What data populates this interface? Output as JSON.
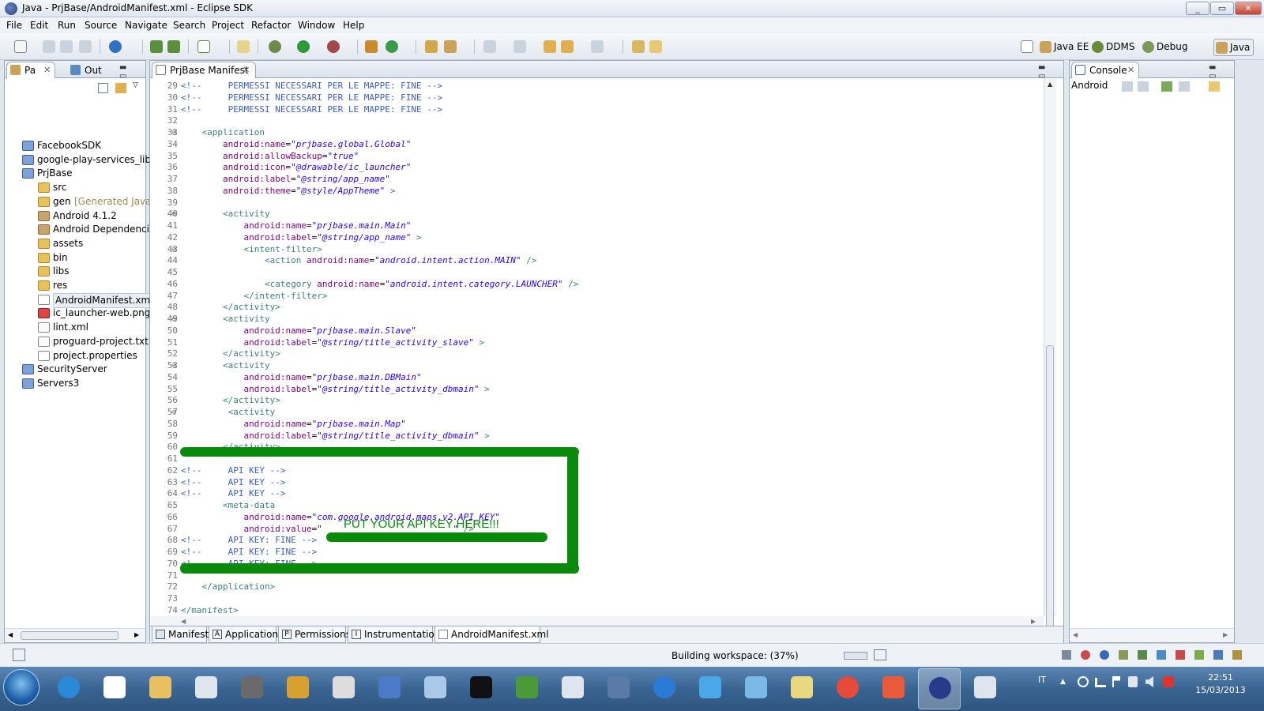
{
  "window": {
    "title": "Java - PrjBase/AndroidManifest.xml - Eclipse SDK"
  },
  "menu": [
    "File",
    "Edit",
    "Run",
    "Source",
    "Navigate",
    "Search",
    "Project",
    "Refactor",
    "Window",
    "Help"
  ],
  "perspectives": [
    {
      "label": "Java EE",
      "icon": "java-ee-perspective-icon"
    },
    {
      "label": "DDMS",
      "icon": "ddms-perspective-icon"
    },
    {
      "label": "Debug",
      "icon": "debug-perspective-icon"
    },
    {
      "label": "Java",
      "icon": "java-perspective-icon",
      "active": true
    }
  ],
  "explorer": {
    "tabs": [
      {
        "label": "Pa"
      },
      {
        "label": "Out"
      }
    ],
    "tree": [
      {
        "label": "FacebookSDK",
        "icon": "project-folder-icon"
      },
      {
        "label": "google-play-services_lib",
        "icon": "project-folder-icon"
      },
      {
        "label": "PrjBase",
        "icon": "project-folder-icon"
      },
      {
        "label": "src",
        "icon": "source-folder-icon"
      },
      {
        "label": "gen",
        "suffix": "[Generated Java F",
        "icon": "source-folder-icon"
      },
      {
        "label": "Android 4.1.2",
        "icon": "library-icon"
      },
      {
        "label": "Android Dependencie",
        "icon": "library-icon"
      },
      {
        "label": "assets",
        "icon": "folder-icon"
      },
      {
        "label": "bin",
        "icon": "folder-icon"
      },
      {
        "label": "libs",
        "icon": "folder-icon"
      },
      {
        "label": "res",
        "icon": "folder-icon"
      },
      {
        "label": "AndroidManifest.xml",
        "icon": "xml-file-icon",
        "selected": true
      },
      {
        "label": "ic_launcher-web.png",
        "icon": "image-file-icon"
      },
      {
        "label": "lint.xml",
        "icon": "xml-file-icon"
      },
      {
        "label": "proguard-project.txt",
        "icon": "text-file-icon"
      },
      {
        "label": "project.properties",
        "icon": "text-file-icon"
      },
      {
        "label": "SecurityServer",
        "icon": "project-folder-icon"
      },
      {
        "label": "Servers3",
        "icon": "project-folder-icon"
      }
    ]
  },
  "editor": {
    "tab_label": "PrjBase Manifest",
    "lines": [
      {
        "n": "29",
        "t": "<!--     PERMESSI NECESSARI PER LE MAPPE: FINE -->"
      },
      {
        "n": "30",
        "t": "<!--     PERMESSI NECESSARI PER LE MAPPE: FINE -->"
      },
      {
        "n": "31",
        "t": "<!--     PERMESSI NECESSARI PER LE MAPPE: FINE -->"
      },
      {
        "n": "32",
        "t": ""
      },
      {
        "n": "33",
        "t": "    <application"
      },
      {
        "n": "34",
        "t": "        android:name=\"prjbase.global.Global\""
      },
      {
        "n": "35",
        "t": "        android:allowBackup=\"true\""
      },
      {
        "n": "36",
        "t": "        android:icon=\"@drawable/ic_launcher\""
      },
      {
        "n": "37",
        "t": "        android:label=\"@string/app_name\""
      },
      {
        "n": "38",
        "t": "        android:theme=\"@style/AppTheme\" >"
      },
      {
        "n": "39",
        "t": ""
      },
      {
        "n": "40",
        "t": "        <activity"
      },
      {
        "n": "41",
        "t": "            android:name=\"prjbase.main.Main\""
      },
      {
        "n": "42",
        "t": "            android:label=\"@string/app_name\" >"
      },
      {
        "n": "43",
        "t": "            <intent-filter>"
      },
      {
        "n": "44",
        "t": "                <action android:name=\"android.intent.action.MAIN\" />"
      },
      {
        "n": "45",
        "t": ""
      },
      {
        "n": "46",
        "t": "                <category android:name=\"android.intent.category.LAUNCHER\" />"
      },
      {
        "n": "47",
        "t": "            </intent-filter>"
      },
      {
        "n": "48",
        "t": "        </activity>"
      },
      {
        "n": "49",
        "t": "        <activity"
      },
      {
        "n": "50",
        "t": "            android:name=\"prjbase.main.Slave\""
      },
      {
        "n": "51",
        "t": "            android:label=\"@string/title_activity_slave\" >"
      },
      {
        "n": "52",
        "t": "        </activity>"
      },
      {
        "n": "53",
        "t": "        <activity"
      },
      {
        "n": "54",
        "t": "            android:name=\"prjbase.main.DBMain\""
      },
      {
        "n": "55",
        "t": "            android:label=\"@string/title_activity_dbmain\" >"
      },
      {
        "n": "56",
        "t": "        </activity>"
      },
      {
        "n": "57",
        "t": "         <activity"
      },
      {
        "n": "58",
        "t": "            android:name=\"prjbase.main.Map\""
      },
      {
        "n": "59",
        "t": "            android:label=\"@string/title_activity_dbmain\" >"
      },
      {
        "n": "60",
        "t": "        </activity>"
      },
      {
        "n": "61",
        "t": ""
      },
      {
        "n": "62",
        "t": "<!--     API KEY -->"
      },
      {
        "n": "63",
        "t": "<!--     API KEY -->"
      },
      {
        "n": "64",
        "t": "<!--     API KEY -->"
      },
      {
        "n": "65",
        "t": "        <meta-data"
      },
      {
        "n": "66",
        "t": "            android:name=\"com.google.android.maps.v2.API_KEY\""
      },
      {
        "n": "67",
        "t": "            android:value=\"                         \" />"
      },
      {
        "n": "68",
        "t": "<!--     API KEY: FINE -->"
      },
      {
        "n": "69",
        "t": "<!--     API KEY: FINE -->"
      },
      {
        "n": "70",
        "t": "<!--     API KEY: FINE -->"
      },
      {
        "n": "71",
        "t": ""
      },
      {
        "n": "72",
        "t": "    </application>"
      },
      {
        "n": "73",
        "t": ""
      },
      {
        "n": "74",
        "t": "</manifest>"
      }
    ],
    "annotation": "PUT YOUR API KEY HERE!!!",
    "bottom_tabs": [
      {
        "label": "Manifest",
        "icon": "manifest-tab-icon"
      },
      {
        "label": "Application",
        "key": "A"
      },
      {
        "label": "Permissions",
        "key": "P"
      },
      {
        "label": "Instrumentation",
        "key": "I"
      },
      {
        "label": "AndroidManifest.xml",
        "icon": "xml-file-icon",
        "active": true
      }
    ]
  },
  "console": {
    "tab_label": "Console",
    "label": "Android"
  },
  "status": {
    "text": "Building workspace: (37%)"
  },
  "taskbar": {
    "apps": [
      "internet-explorer-icon",
      "7zip-icon",
      "explorer-icon",
      "calculator-icon",
      "gimp-icon",
      "tool-icon",
      "database-icon",
      "network-icon",
      "settings-icon",
      "terminal-icon",
      "chart-icon",
      "window-icon",
      "java-icon",
      "media-player-icon",
      "flash-icon",
      "monitor-icon",
      "folder-icon",
      "chrome-icon",
      "pdf-icon",
      "eclipse-icon",
      "download-icon"
    ],
    "active_index": 19,
    "lang": "IT",
    "time": "22:51",
    "date": "15/03/2013"
  },
  "colors": {
    "highlight": "#0a8a0a",
    "comment": "#3f5fbf",
    "tag": "#3f7f7f",
    "attr": "#7f007f",
    "value": "#2a00ff"
  }
}
